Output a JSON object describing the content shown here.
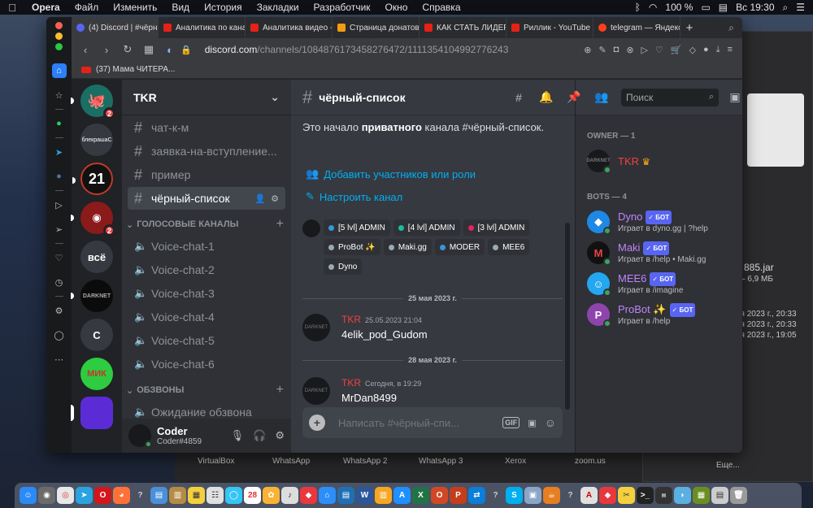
{
  "menubar": {
    "items": [
      "Opera",
      "Файл",
      "Изменить",
      "Вид",
      "История",
      "Закладки",
      "Разработчик",
      "Окно",
      "Справка"
    ],
    "battery": "100 %",
    "clock": "Вс 19:30"
  },
  "desktop": {
    "file_name": "885.jar",
    "file_size": "– 6,9 МБ",
    "dates": [
      "ня 2023 г., 20:33",
      "ня 2023 г., 20:33",
      "ня 2023 г., 19:05"
    ],
    "apps": [
      "VirtualBox",
      "WhatsApp",
      "WhatsApp 2",
      "WhatsApp 3",
      "Xerox",
      "zoom.us"
    ],
    "more": "Еще..."
  },
  "browser": {
    "tabs": [
      "(4) Discord | #чёрн",
      "Аналитика по кана",
      "Аналитика видео -",
      "Страница донатов",
      "КАК СТАТЬ ЛИДЕР",
      "Риллик - YouTube",
      "telegram — Яндекс"
    ],
    "url_host": "discord.com",
    "url_path": "/channels/1084876173458276472/1111354104992776243",
    "bookmark": "(37) Мама ЧИТЕРА..."
  },
  "server": {
    "name": "TKR",
    "channels_text": [
      "чат-к-м",
      "заявка-на-вступление...",
      "пример",
      "чёрный-список"
    ],
    "voice_category": "ГОЛОСОВЫЕ КАНАЛЫ",
    "voice_channels": [
      "Voice-chat-1",
      "Voice-chat-2",
      "Voice-chat-3",
      "Voice-chat-4",
      "Voice-chat-5",
      "Voice-chat-6"
    ],
    "obzvon_category": "ОБЗВОНЫ",
    "obzvon_channels": [
      "Ожидание обзвона"
    ]
  },
  "guilds": [
    {
      "label": "",
      "badge": "2"
    },
    {
      "label": "блекрашаС",
      "badge": ""
    },
    {
      "label": "21",
      "badge": ""
    },
    {
      "label": "",
      "badge": "2"
    },
    {
      "label": "всё",
      "badge": ""
    },
    {
      "label": "DARKNET",
      "badge": ""
    },
    {
      "label": "С",
      "badge": ""
    },
    {
      "label": "МИК",
      "badge": ""
    },
    {
      "label": "",
      "badge": ""
    }
  ],
  "user": {
    "name": "Coder",
    "tag": "Coder#4859"
  },
  "chat": {
    "channel_title": "чёрный-список",
    "search_placeholder": "Поиск",
    "intro_pre": "Это начало ",
    "intro_bold": "приватного",
    "intro_post": " канала #чёрный-список.",
    "add_link": "Добавить участников или роли",
    "setup_link": "Настроить канал",
    "roles": [
      {
        "name": "[5 lvl] ADMIN",
        "color": "#3498db"
      },
      {
        "name": "[4 lvl] ADMIN",
        "color": "#1abc9c"
      },
      {
        "name": "[3 lvl] ADMIN",
        "color": "#e91e63"
      },
      {
        "name": "ProBot ✨",
        "color": "#99aab5"
      },
      {
        "name": "Maki.gg",
        "color": "#99aab5"
      },
      {
        "name": "MODER",
        "color": "#3498db"
      },
      {
        "name": "MEE6",
        "color": "#99aab5"
      },
      {
        "name": "Dyno",
        "color": "#99aab5"
      }
    ],
    "messages": [
      {
        "divider": "25 мая 2023 г.",
        "author": "TKR",
        "time": "25.05.2023 21:04",
        "text": "4elik_pod_Gudom"
      },
      {
        "divider": "28 мая 2023 г.",
        "author": "TKR",
        "time": "Сегодня, в 19:29",
        "text": "MrDan8499"
      }
    ],
    "input_placeholder": "Написать #чёрный-спи...",
    "gif_label": "GIF"
  },
  "members": {
    "owner_header": "OWNER — 1",
    "owner": {
      "name": "TKR",
      "crown": "♛"
    },
    "bots_header": "BOTS — 4",
    "bot_badge": "✓ БОТ",
    "bots": [
      {
        "name": "Dyno",
        "activity": "Играет в dyno.gg | ?help",
        "color": "#1e88e5"
      },
      {
        "name": "Maki",
        "activity": "Играет в /help • Maki.gg",
        "color": "#ed4245"
      },
      {
        "name": "MEE6",
        "activity": "Играет в /imagine",
        "color": "#22a7f0"
      },
      {
        "name": "ProBot ✨",
        "activity": "Играет в /help",
        "color": "#8e44ad"
      }
    ]
  }
}
